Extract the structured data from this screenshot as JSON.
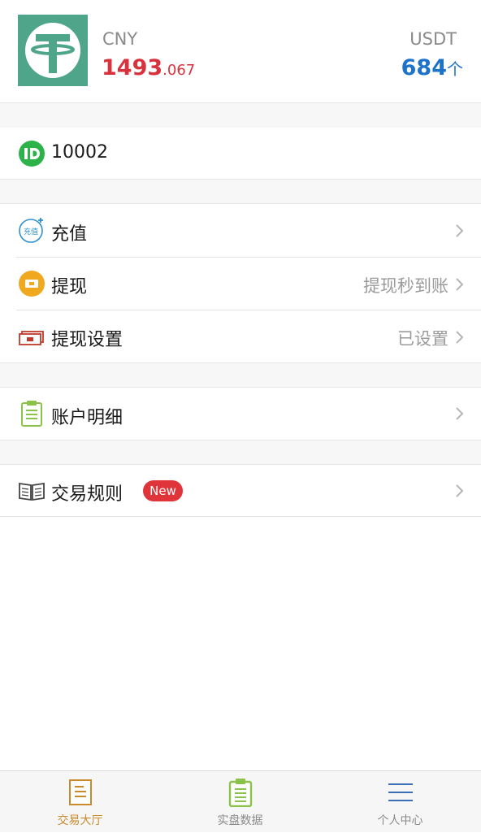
{
  "balance": {
    "cny_label": "CNY",
    "cny_int": "1493",
    "cny_frac": ".067",
    "usdt_label": "USDT",
    "usdt_amount": "684",
    "usdt_unit": "个",
    "logo_icon": "tether-logo",
    "cny_color": "#d8323c",
    "usdt_color": "#1d73c9"
  },
  "account": {
    "id_icon": "id-icon",
    "id_value": "10002"
  },
  "menu": {
    "recharge": {
      "label": "充值",
      "icon": "recharge-icon"
    },
    "withdraw": {
      "label": "提现",
      "value": "提现秒到账",
      "icon": "withdraw-icon"
    },
    "withdraw_settings": {
      "label": "提现设置",
      "value": "已设置",
      "icon": "card-icon"
    },
    "account_details": {
      "label": "账户明细",
      "icon": "clipboard-icon"
    },
    "trade_rules": {
      "label": "交易规则",
      "badge": "New",
      "icon": "book-icon"
    }
  },
  "tabbar": {
    "tabs": [
      {
        "label": "交易大厅",
        "icon": "document-icon",
        "active": true
      },
      {
        "label": "实盘数据",
        "icon": "clipboard-icon",
        "active": false
      },
      {
        "label": "个人中心",
        "icon": "menu-icon",
        "active": false
      }
    ],
    "active_color": "#c98a2c"
  }
}
